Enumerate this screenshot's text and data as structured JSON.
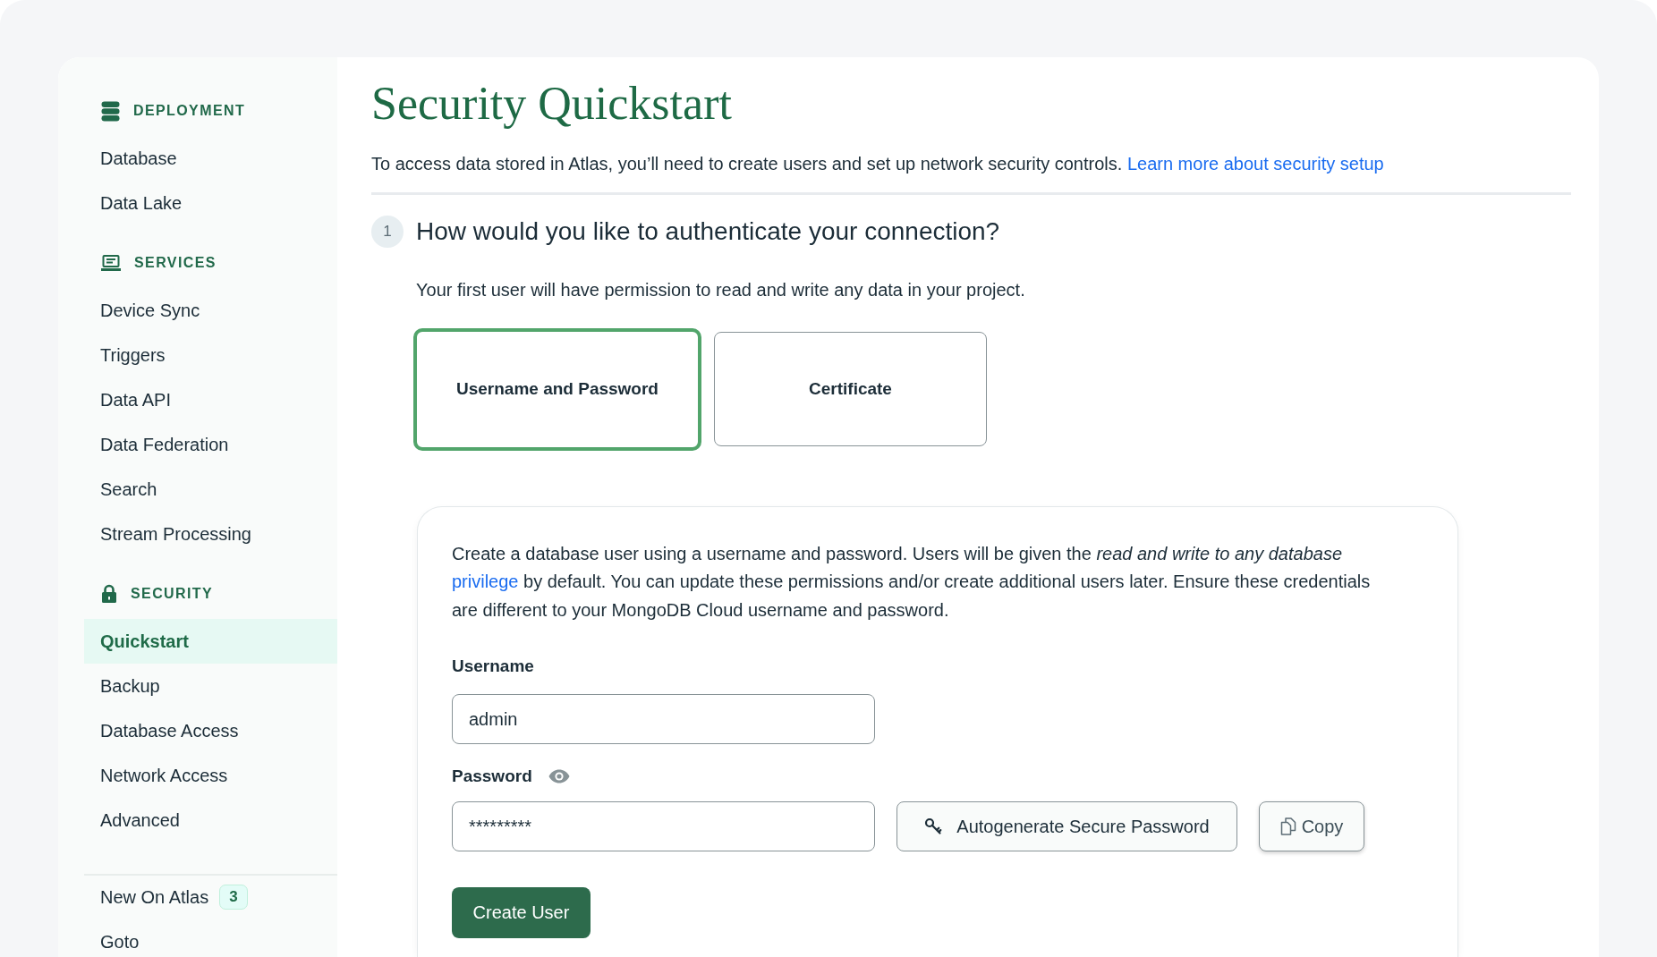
{
  "sidebar": {
    "sections": [
      {
        "title": "DEPLOYMENT",
        "items": [
          {
            "label": "Database",
            "selected": false
          },
          {
            "label": "Data Lake",
            "selected": false
          }
        ]
      },
      {
        "title": "SERVICES",
        "items": [
          {
            "label": "Device Sync",
            "selected": false
          },
          {
            "label": "Triggers",
            "selected": false
          },
          {
            "label": "Data API",
            "selected": false
          },
          {
            "label": "Data Federation",
            "selected": false
          },
          {
            "label": "Search",
            "selected": false
          },
          {
            "label": "Stream Processing",
            "selected": false
          }
        ]
      },
      {
        "title": "SECURITY",
        "items": [
          {
            "label": "Quickstart",
            "selected": true
          },
          {
            "label": "Backup",
            "selected": false
          },
          {
            "label": "Database Access",
            "selected": false
          },
          {
            "label": "Network Access",
            "selected": false
          },
          {
            "label": "Advanced",
            "selected": false
          }
        ]
      }
    ],
    "footer_items": [
      {
        "label": "New On Atlas",
        "badge": "3"
      },
      {
        "label": "Goto"
      }
    ]
  },
  "page": {
    "title": "Security Quickstart",
    "intro": {
      "text": "To access data stored in Atlas, you’ll need to create users and set up network security controls.",
      "link": "Learn more about security setup"
    }
  },
  "step": {
    "number": "1",
    "question": "How would you like to authenticate your connection?",
    "note": "Your first user will have permission to read and write any data in your project."
  },
  "auth_options": [
    {
      "label": "Username and Password",
      "selected": true
    },
    {
      "label": "Certificate",
      "selected": false
    }
  ],
  "user_form": {
    "description": {
      "before": "Create a database user using a username and password. Users will be given the *read and write to any database*",
      "link": "privilege",
      "after": "by default. You can update these permissions and/or create additional users later. Ensure these credentials are different to your MongoDB Cloud username and password."
    },
    "username": {
      "label": "Username",
      "value": "admin"
    },
    "password": {
      "label": "Password",
      "value": "*********"
    },
    "generate_button": "Autogenerate Secure Password",
    "copy_button": "Copy",
    "submit_button": "Create User"
  }
}
